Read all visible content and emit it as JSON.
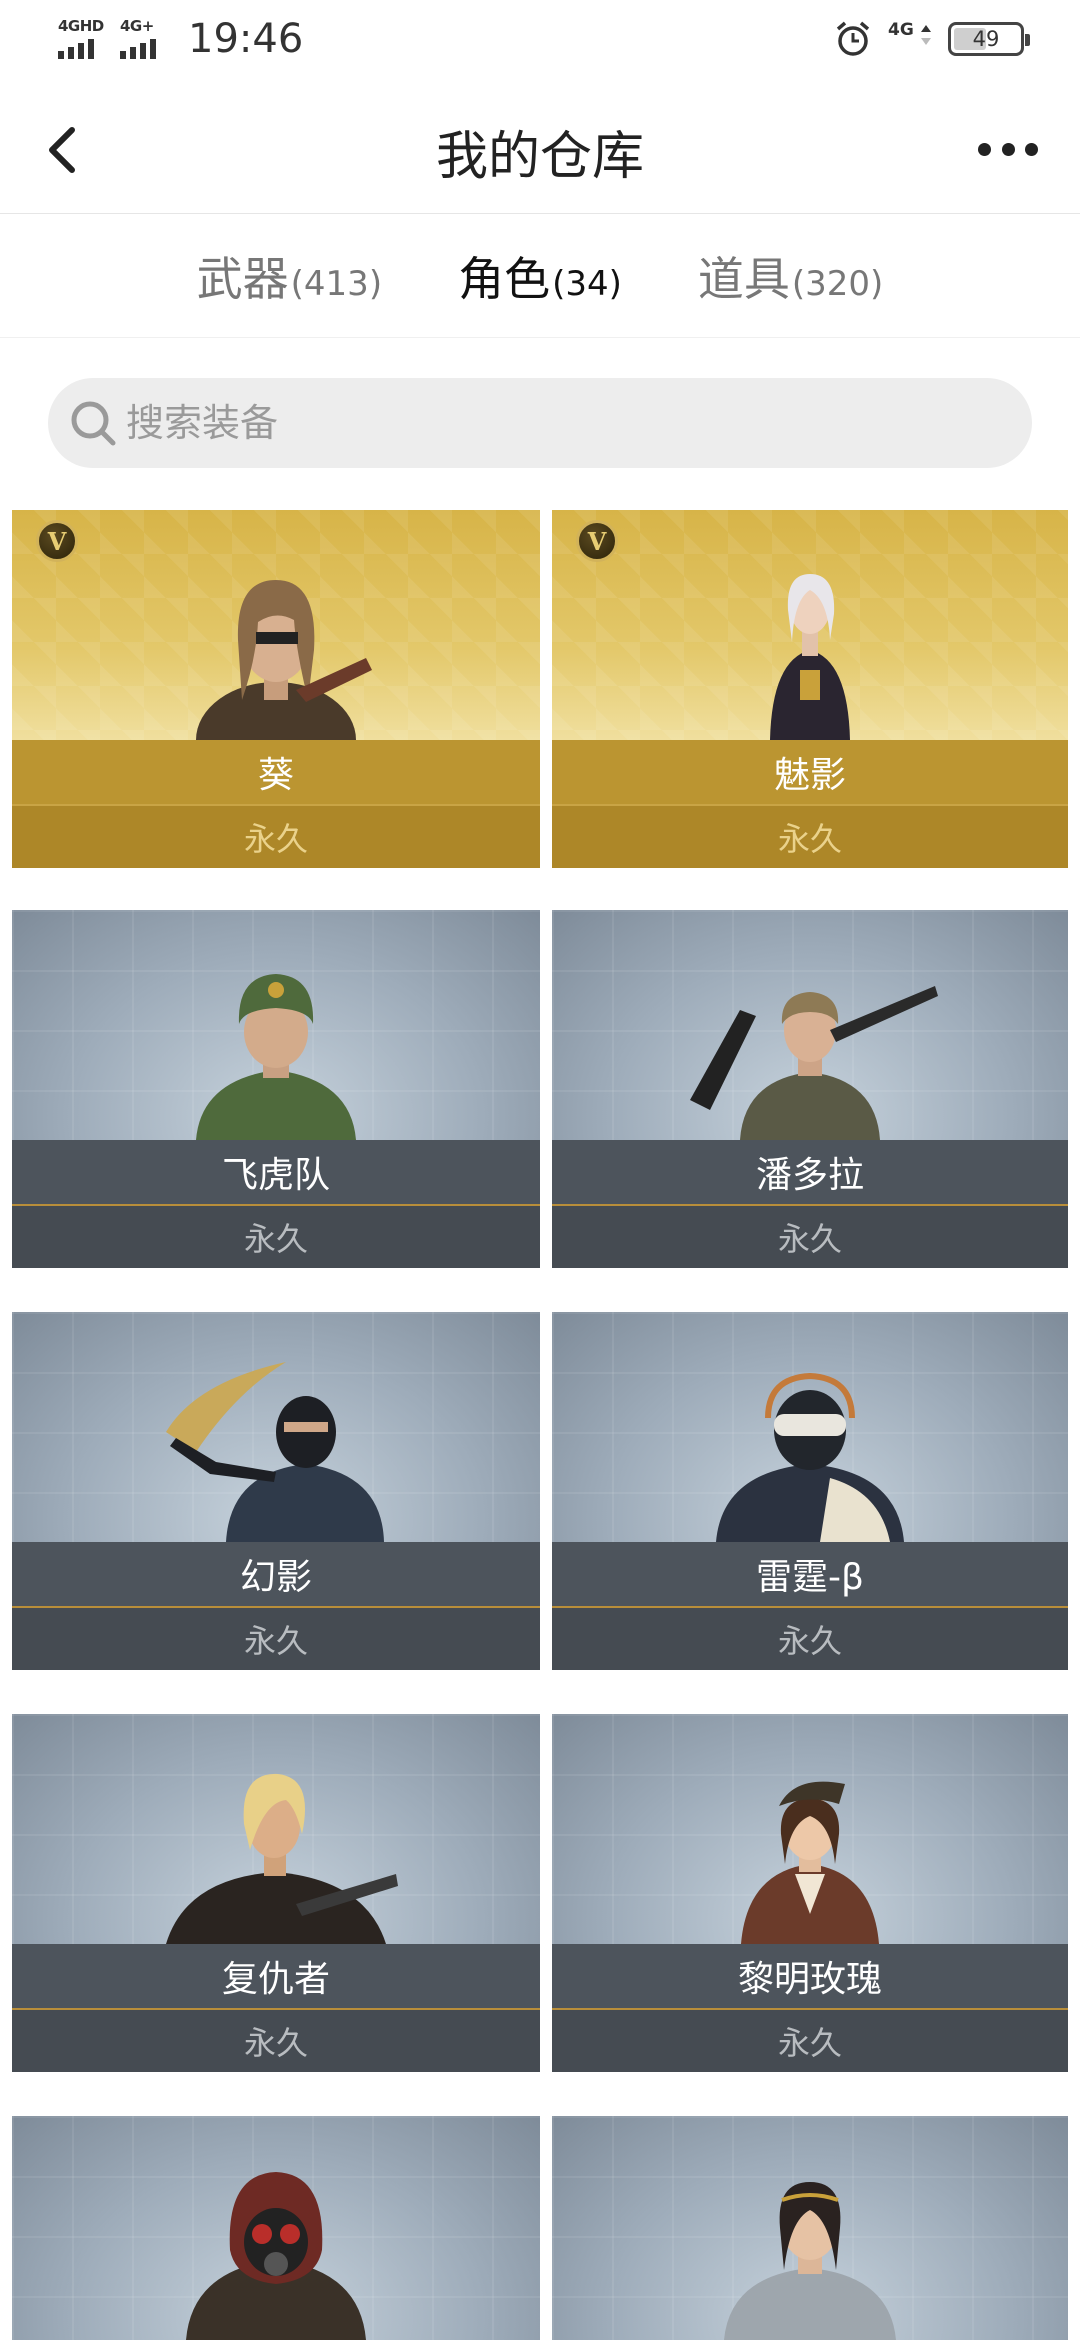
{
  "status_bar": {
    "network_left_1": "4GHD",
    "network_left_2": "4G+",
    "time": "19:46",
    "network_right": "4G",
    "battery": "49"
  },
  "header": {
    "title": "我的仓库"
  },
  "tabs": [
    {
      "label": "武器",
      "count": "(413)"
    },
    {
      "label": "角色",
      "count": "(34)"
    },
    {
      "label": "道具",
      "count": "(320)"
    }
  ],
  "search": {
    "placeholder": "搜索装备"
  },
  "items": [
    {
      "name": "葵",
      "duration": "永久",
      "vip": true
    },
    {
      "name": "魅影",
      "duration": "永久",
      "vip": true
    },
    {
      "name": "飞虎队",
      "duration": "永久",
      "vip": false
    },
    {
      "name": "潘多拉",
      "duration": "永久",
      "vip": false
    },
    {
      "name": "幻影",
      "duration": "永久",
      "vip": false
    },
    {
      "name": "雷霆-β",
      "duration": "永久",
      "vip": false
    },
    {
      "name": "复仇者",
      "duration": "永久",
      "vip": false
    },
    {
      "name": "黎明玫瑰",
      "duration": "永久",
      "vip": false
    }
  ],
  "vip_badge": "V"
}
